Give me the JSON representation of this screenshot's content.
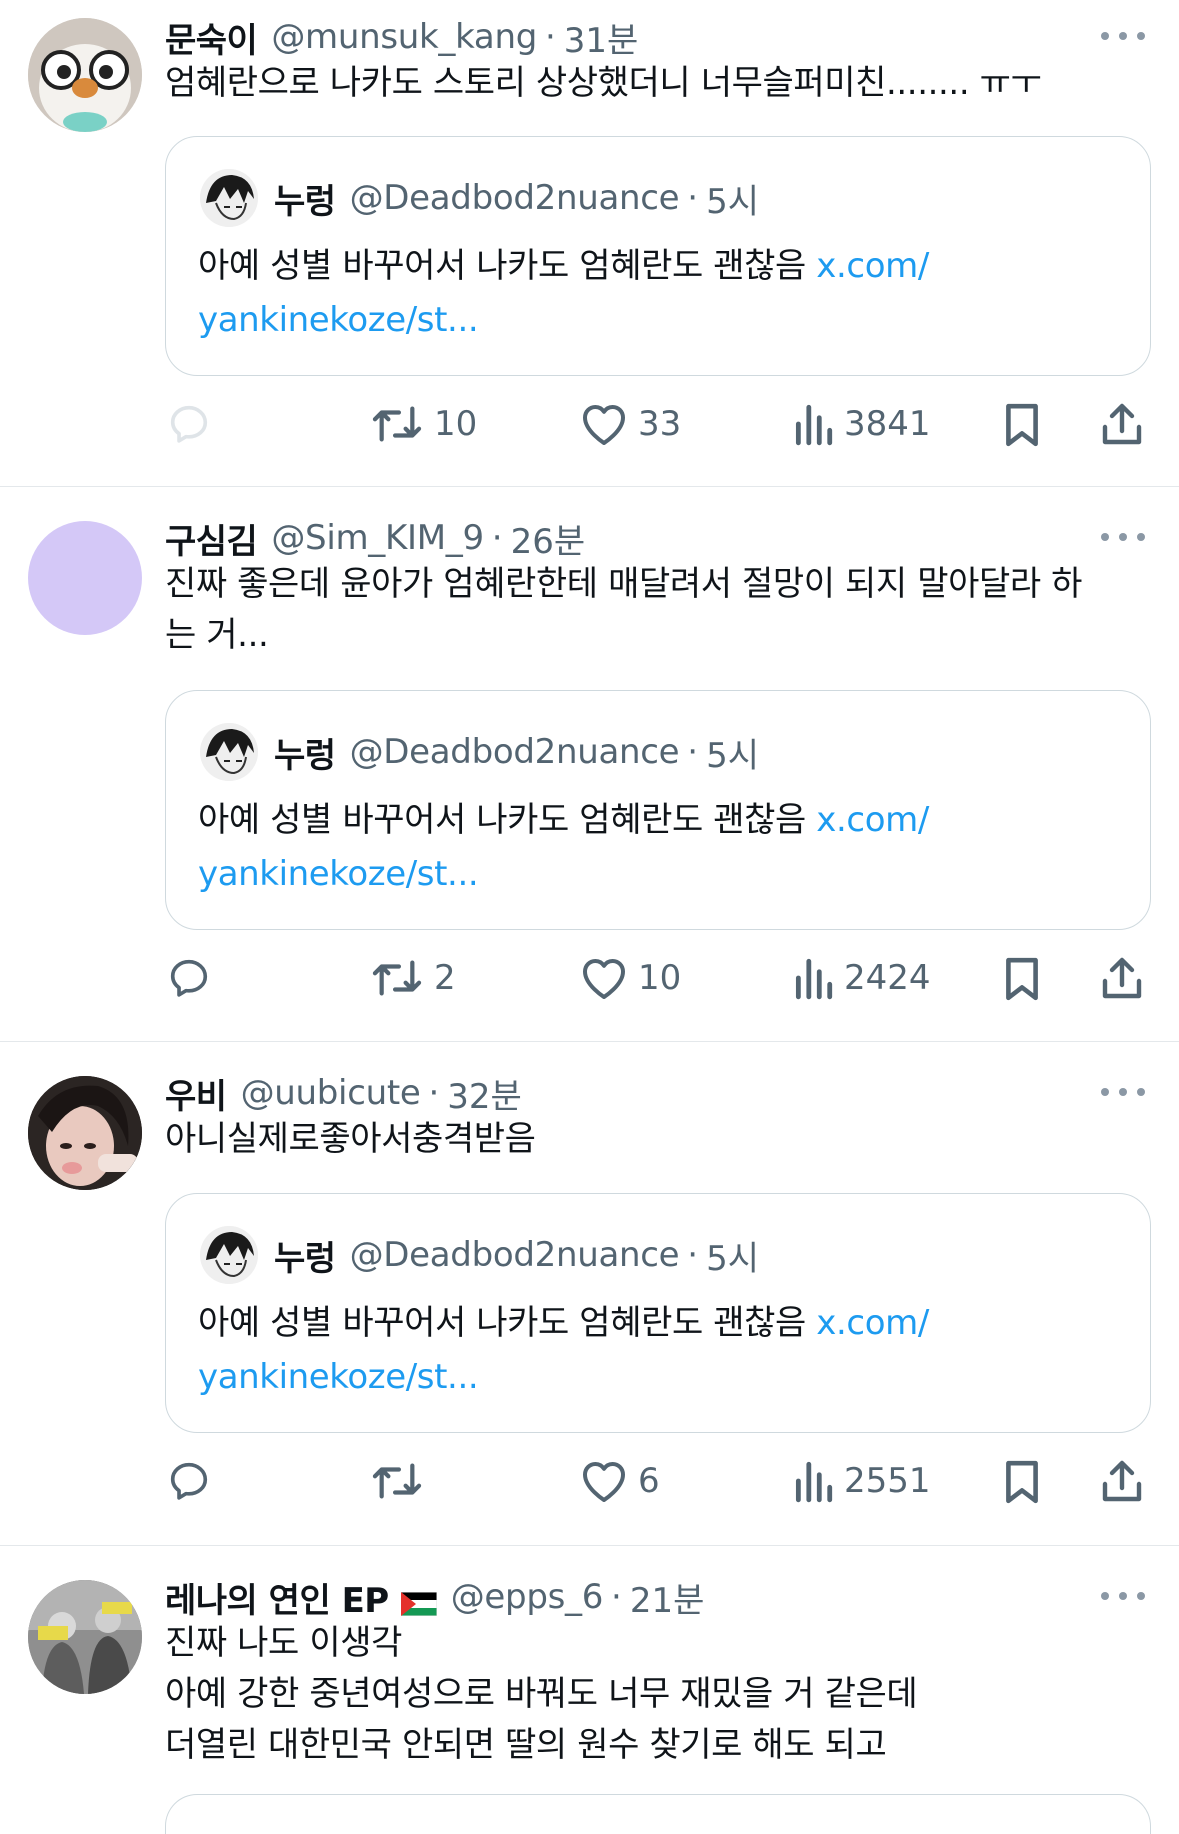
{
  "tweets": [
    {
      "name": "문숙이",
      "handle": "@munsuk_kang",
      "time": "31분",
      "text": "엄혜란으로 나카도 스토리 상상했더니 너무슬퍼미친........ ㅠㅜ",
      "quote": {
        "name": "누렁",
        "handle": "@Deadbod2nuance",
        "time": "5시",
        "text": "아예 성별 바꾸어서 나카도 엄혜란도 괜찮음 ",
        "link_part1": "x.com/",
        "link_part2": "yankinekoze/st..."
      },
      "reply_count": "",
      "retweet_count": "10",
      "like_count": "33",
      "view_count": "3841"
    },
    {
      "name": "구심김",
      "handle": "@Sim_KIM_9",
      "time": "26분",
      "text": "진짜 좋은데 윤아가 엄혜란한테 매달려서 절망이 되지 말아달라 하\n는 거...",
      "quote": {
        "name": "누렁",
        "handle": "@Deadbod2nuance",
        "time": "5시",
        "text": "아예 성별 바꾸어서 나카도 엄혜란도 괜찮음 ",
        "link_part1": "x.com/",
        "link_part2": "yankinekoze/st..."
      },
      "reply_count": "",
      "retweet_count": "2",
      "like_count": "10",
      "view_count": "2424"
    },
    {
      "name": "우비",
      "handle": "@uubicute",
      "time": "32분",
      "text": "아니실제로좋아서충격받음",
      "quote": {
        "name": "누렁",
        "handle": "@Deadbod2nuance",
        "time": "5시",
        "text": "아예 성별 바꾸어서 나카도 엄혜란도 괜찮음 ",
        "link_part1": "x.com/",
        "link_part2": "yankinekoze/st..."
      },
      "reply_count": "",
      "retweet_count": "",
      "like_count": "6",
      "view_count": "2551"
    },
    {
      "name": "레나의 연인 EP",
      "handle": "@epps_6",
      "time": "21분",
      "text": "진짜 나도 이생각\n아예 강한 중년여성으로 바꿔도 너무 재밌을 거 같은데\n더열린 대한민국 안되면 딸의 원수 찾기로 해도 되고"
    }
  ],
  "separator": "·",
  "colors": {
    "accent": "#1d9bf0",
    "secondary_text": "#536471",
    "border": "#cfd9de",
    "avatar_gusimgim": "#d4c8f7"
  },
  "icons": [
    "reply-icon",
    "retweet-icon",
    "like-icon",
    "views-icon",
    "bookmark-icon",
    "share-icon",
    "more-icon",
    "palestine-flag-icon"
  ]
}
